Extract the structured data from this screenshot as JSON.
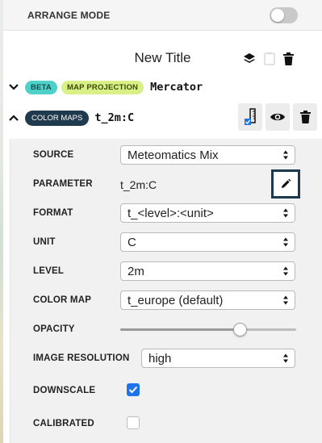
{
  "arrange_mode": {
    "label": "ARRANGE MODE",
    "enabled": false
  },
  "header": {
    "title": "New Title"
  },
  "projection_row": {
    "badge": "BETA",
    "label": "MAP PROJECTION",
    "value": "Mercator"
  },
  "layer": {
    "badge": "COLOR MAPS",
    "name": "t_2m:C"
  },
  "settings": {
    "source": {
      "label": "SOURCE",
      "value": "Meteomatics Mix"
    },
    "parameter": {
      "label": "PARAMETER",
      "value": "t_2m:C"
    },
    "format": {
      "label": "FORMAT",
      "value": "t_<level>:<unit>"
    },
    "unit": {
      "label": "UNIT",
      "value": "C"
    },
    "level": {
      "label": "LEVEL",
      "value": "2m"
    },
    "color_map": {
      "label": "COLOR MAP",
      "value": "t_europe (default)"
    },
    "opacity": {
      "label": "OPACITY",
      "value": 0.68
    },
    "image_resolution": {
      "label": "IMAGE RESOLUTION",
      "value": "high"
    },
    "downscale": {
      "label": "DOWNSCALE",
      "checked": true
    },
    "calibrated": {
      "label": "CALIBRATED",
      "checked": false
    }
  },
  "colors": {
    "accent": "#1f73e8",
    "dark": "#1c3a4e",
    "beta": "#4fd0c8",
    "projection": "#d8f086"
  }
}
